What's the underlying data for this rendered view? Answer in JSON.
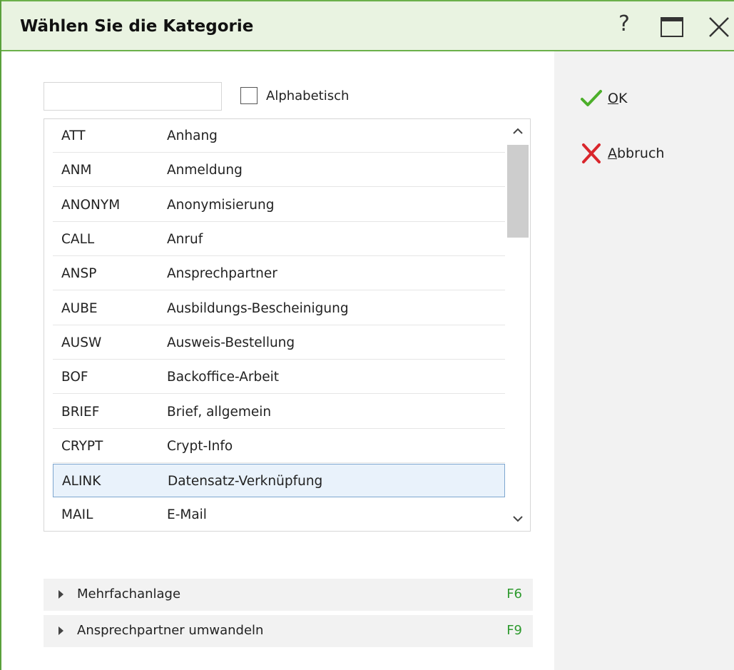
{
  "window": {
    "title": "Wählen Sie die Kategorie",
    "help_label": "?"
  },
  "search": {
    "value": "",
    "placeholder": ""
  },
  "alphabetical": {
    "label": "Alphabetisch",
    "checked": false
  },
  "list": {
    "rows": [
      {
        "code": "ATT",
        "desc": "Anhang"
      },
      {
        "code": "ANM",
        "desc": "Anmeldung"
      },
      {
        "code": "ANONYM",
        "desc": "Anonymisierung"
      },
      {
        "code": "CALL",
        "desc": "Anruf"
      },
      {
        "code": "ANSP",
        "desc": "Ansprechpartner"
      },
      {
        "code": "AUBE",
        "desc": "Ausbildungs-Bescheinigung"
      },
      {
        "code": "AUSW",
        "desc": "Ausweis-Bestellung"
      },
      {
        "code": "BOF",
        "desc": "Backoffice-Arbeit"
      },
      {
        "code": "BRIEF",
        "desc": "Brief, allgemein"
      },
      {
        "code": "CRYPT",
        "desc": "Crypt-Info"
      },
      {
        "code": "ALINK",
        "desc": "Datensatz-Verknüpfung"
      },
      {
        "code": "MAIL",
        "desc": "E-Mail"
      }
    ],
    "selected_code": "ALINK"
  },
  "actions": {
    "ok": {
      "mnemonic": "O",
      "rest": "K",
      "icon": "check-icon"
    },
    "cancel": {
      "mnemonic": "A",
      "rest": "bbruch",
      "icon": "cross-icon"
    }
  },
  "expanders": [
    {
      "label": "Mehrfachanlage",
      "key": "F6"
    },
    {
      "label": "Ansprechpartner umwandeln",
      "key": "F9"
    }
  ],
  "colors": {
    "title_bg": "#e9f3e1",
    "accent_green": "#5aa03c",
    "ok_green": "#4caf2a",
    "cancel_red": "#d9262c",
    "selection_bg": "#e9f2fb",
    "selection_border": "#7ea6cf",
    "shortcut_green": "#2e9a2e"
  }
}
